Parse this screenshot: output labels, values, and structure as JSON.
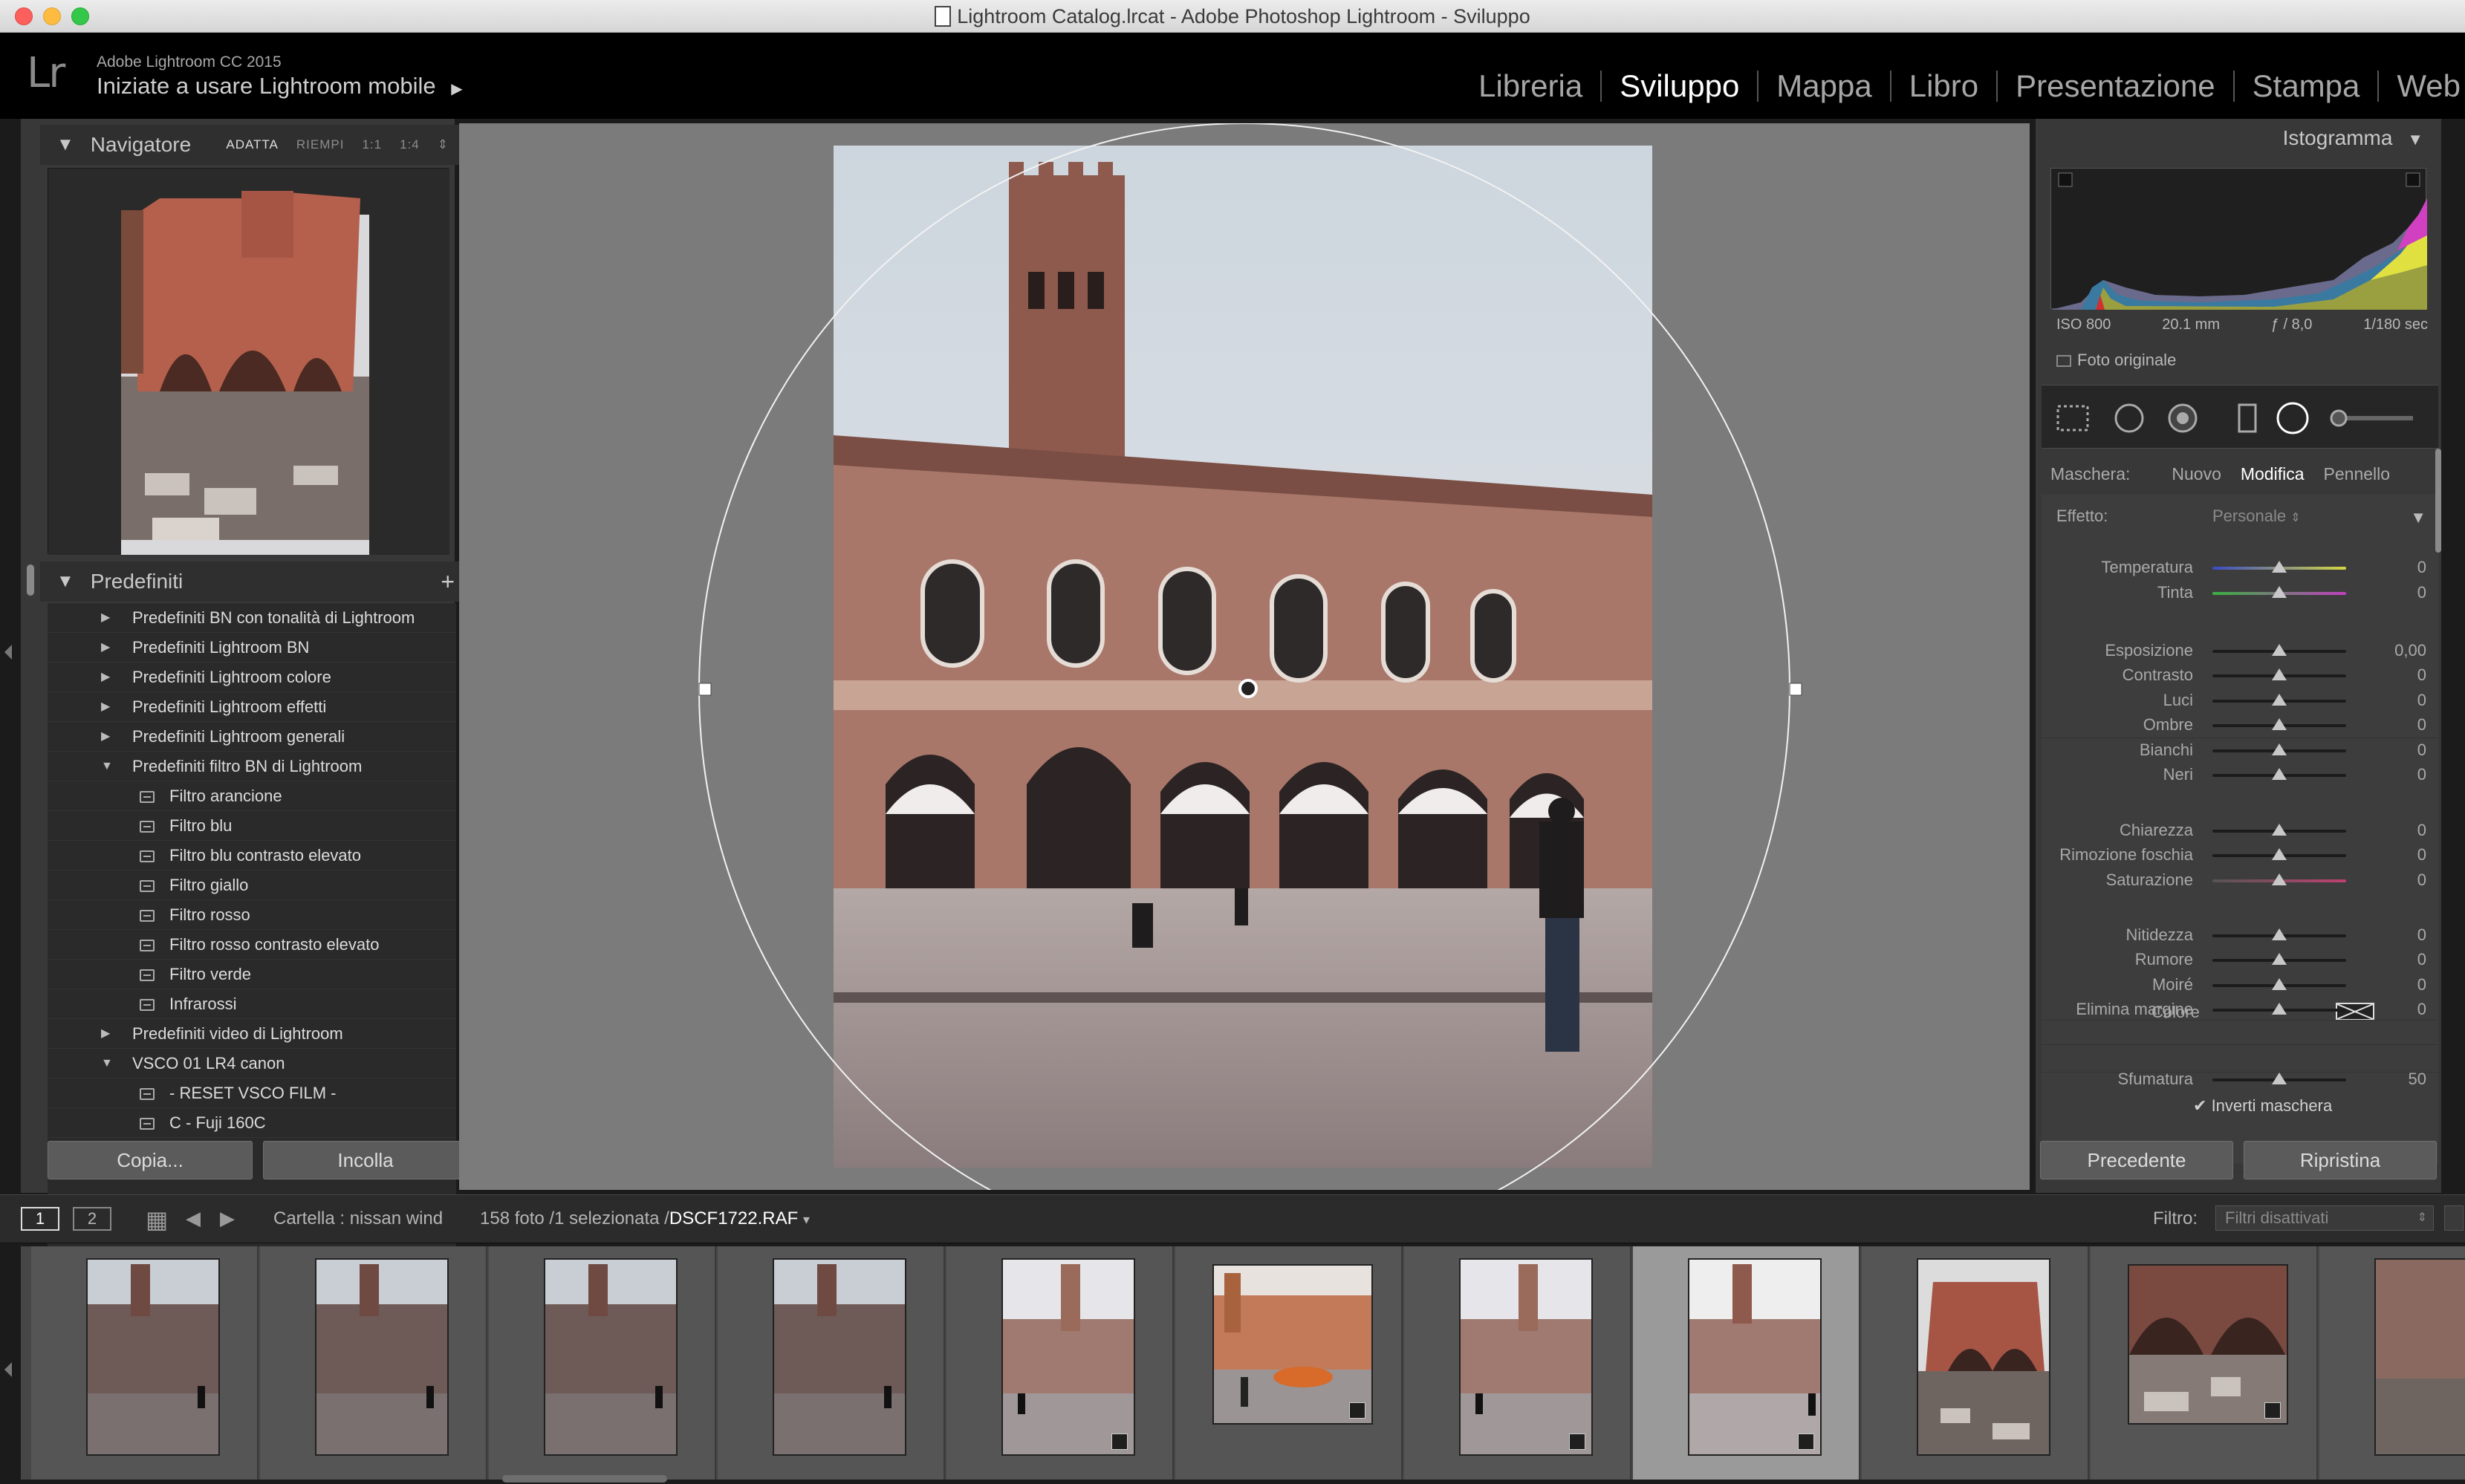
{
  "window": {
    "title": "Lightroom Catalog.lrcat - Adobe Photoshop Lightroom - Sviluppo"
  },
  "identity": {
    "logo": "Lr",
    "product": "Adobe Lightroom CC 2015",
    "prompt": "Iniziate a usare Lightroom mobile",
    "prompt_arrow": "▶"
  },
  "modules": [
    "Libreria",
    "Sviluppo",
    "Mappa",
    "Libro",
    "Presentazione",
    "Stampa",
    "Web"
  ],
  "active_module": "Sviluppo",
  "navigator": {
    "title": "Navigatore",
    "options": [
      "ADATTA",
      "RIEMPI",
      "1:1",
      "1:4"
    ],
    "active": "ADATTA"
  },
  "presets": {
    "title": "Predefiniti",
    "add_label": "+",
    "items": [
      {
        "label": "Predefiniti BN con tonalità di Lightroom",
        "level": 0,
        "expanded": false
      },
      {
        "label": "Predefiniti Lightroom BN",
        "level": 0,
        "expanded": false
      },
      {
        "label": "Predefiniti Lightroom colore",
        "level": 0,
        "expanded": false
      },
      {
        "label": "Predefiniti Lightroom effetti",
        "level": 0,
        "expanded": false
      },
      {
        "label": "Predefiniti Lightroom generali",
        "level": 0,
        "expanded": false
      },
      {
        "label": "Predefiniti filtro BN di Lightroom",
        "level": 0,
        "expanded": true
      },
      {
        "label": "Filtro arancione",
        "level": 1
      },
      {
        "label": "Filtro blu",
        "level": 1
      },
      {
        "label": "Filtro blu contrasto elevato",
        "level": 1
      },
      {
        "label": "Filtro giallo",
        "level": 1
      },
      {
        "label": "Filtro rosso",
        "level": 1
      },
      {
        "label": "Filtro rosso contrasto elevato",
        "level": 1
      },
      {
        "label": "Filtro verde",
        "level": 1
      },
      {
        "label": "Infrarossi",
        "level": 1
      },
      {
        "label": "Predefiniti video di Lightroom",
        "level": 0,
        "expanded": false
      },
      {
        "label": "VSCO 01 LR4 canon",
        "level": 0,
        "expanded": true
      },
      {
        "label": "- RESET VSCO FILM -",
        "level": 1
      },
      {
        "label": "C - Fuji 160C",
        "level": 1
      }
    ]
  },
  "left_buttons": {
    "copy": "Copia...",
    "paste": "Incolla"
  },
  "histogram": {
    "title": "Istogramma",
    "iso": "ISO 800",
    "focal": "20.1 mm",
    "aperture": "ƒ / 8,0",
    "shutter": "1/180 sec",
    "original_label": "Foto originale"
  },
  "mask": {
    "label": "Maschera:",
    "new": "Nuovo",
    "edit": "Modifica",
    "brush": "Pennello",
    "active": "Modifica"
  },
  "effect": {
    "label": "Effetto:",
    "value": "Personale"
  },
  "sliders": [
    {
      "label": "Temperatura",
      "value": "0",
      "pos": 0.5,
      "track": "temp"
    },
    {
      "label": "Tinta",
      "value": "0",
      "pos": 0.5,
      "track": "tint"
    },
    {
      "label": "Esposizione",
      "value": "0,00",
      "pos": 0.5
    },
    {
      "label": "Contrasto",
      "value": "0",
      "pos": 0.5
    },
    {
      "label": "Luci",
      "value": "0",
      "pos": 0.5
    },
    {
      "label": "Ombre",
      "value": "0",
      "pos": 0.5
    },
    {
      "label": "Bianchi",
      "value": "0",
      "pos": 0.5
    },
    {
      "label": "Neri",
      "value": "0",
      "pos": 0.5
    },
    {
      "label": "Chiarezza",
      "value": "0",
      "pos": 0.5
    },
    {
      "label": "Rimozione foschia",
      "value": "0",
      "pos": 0.5
    },
    {
      "label": "Saturazione",
      "value": "0",
      "pos": 0.5,
      "track": "sat"
    },
    {
      "label": "Nitidezza",
      "value": "0",
      "pos": 0.5
    },
    {
      "label": "Rumore",
      "value": "0",
      "pos": 0.5
    },
    {
      "label": "Moiré",
      "value": "0",
      "pos": 0.5
    },
    {
      "label": "Elimina margine",
      "value": "0",
      "pos": 0.5
    }
  ],
  "color_label": "Colore",
  "feather": {
    "label": "Sfumatura",
    "value": "50",
    "pos": 0.5
  },
  "invert_label": "Inverti maschera",
  "right_buttons": {
    "prev": "Precedente",
    "reset": "Ripristina"
  },
  "toolbar": {
    "screen1": "1",
    "screen2": "2",
    "folder": "Cartella : nissan wind",
    "count": "158 foto /1 selezionata /",
    "file": "DSCF1722.RAF",
    "file_arrow": "▾",
    "filter_label": "Filtro:",
    "filter_value": "Filtri disattivati"
  },
  "filmstrip": [
    {
      "kind": "square-gray",
      "badge": false
    },
    {
      "kind": "square-gray",
      "badge": false
    },
    {
      "kind": "square-gray",
      "badge": false
    },
    {
      "kind": "square-gray",
      "badge": false
    },
    {
      "kind": "square-light",
      "badge": true
    },
    {
      "kind": "car",
      "badge": true
    },
    {
      "kind": "square-light",
      "badge": true
    },
    {
      "kind": "square-sel",
      "badge": true,
      "selected": true
    },
    {
      "kind": "palazzo",
      "badge": false
    },
    {
      "kind": "arches",
      "badge": true
    },
    {
      "kind": "partial",
      "badge": false
    }
  ],
  "colors": {
    "accent_bg": "#383838",
    "selected_cell": "#9a9a9a",
    "panel_bg": "#3d3d3d"
  }
}
